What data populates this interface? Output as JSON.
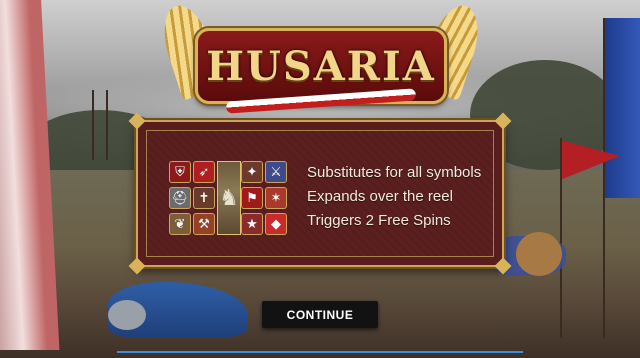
{
  "game": {
    "title": "HUSARIA"
  },
  "panel": {
    "lines": [
      "Substitutes for all symbols",
      "Expands over the reel",
      "Triggers 2 Free Spins"
    ],
    "symbols": [
      {
        "name": "shield-symbol",
        "color": "#8b1a1a",
        "glyph": "⛨"
      },
      {
        "name": "bow-symbol",
        "color": "#b01f1f",
        "glyph": "➶"
      },
      {
        "name": "crest-symbol",
        "color": "#6b3a2a",
        "glyph": "✦"
      },
      {
        "name": "lance-symbol",
        "color": "#3e4a8a",
        "glyph": "⚔"
      },
      {
        "name": "helmet-symbol",
        "color": "#6c6c6c",
        "glyph": "⛑"
      },
      {
        "name": "sword-symbol",
        "color": "#6a3b2b",
        "glyph": "✝"
      },
      {
        "name": "banner-symbol",
        "color": "#a11a1a",
        "glyph": "⚑"
      },
      {
        "name": "flag-symbol",
        "color": "#a8392b",
        "glyph": "✶"
      },
      {
        "name": "wing-symbol",
        "color": "#7b5d3c",
        "glyph": "❦"
      },
      {
        "name": "axe-symbol",
        "color": "#964025",
        "glyph": "⚒"
      },
      {
        "name": "star-symbol",
        "color": "#8c2b2b",
        "glyph": "★"
      },
      {
        "name": "gem-symbol",
        "color": "#c92a2a",
        "glyph": "◆"
      }
    ],
    "wild_glyph": "♞"
  },
  "continue_button": {
    "label": "CONTINUE"
  },
  "colors": {
    "panel_bg": "#5b1f1f",
    "gold": "#c9a65a",
    "button_bg": "#121212",
    "progress": "#3a8fe0"
  }
}
